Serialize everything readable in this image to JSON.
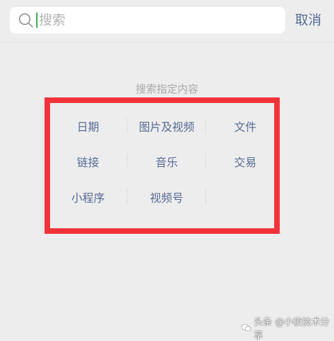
{
  "search": {
    "placeholder": "搜索",
    "value": "",
    "cancel_label": "取消"
  },
  "section": {
    "title": "搜索指定内容"
  },
  "options": {
    "row1": [
      "日期",
      "图片及视频",
      "文件"
    ],
    "row2": [
      "链接",
      "音乐",
      "交易"
    ],
    "row3": [
      "小程序",
      "视频号"
    ]
  },
  "watermark": {
    "text": "头条 @小夜技术分享"
  },
  "colors": {
    "background": "#ededed",
    "link_blue": "#576b95",
    "highlight_red": "#f2333a",
    "cursor_green": "#3ab34a"
  },
  "icons": {
    "search": "search-icon",
    "watermark_logo": "chat-bubble-icon"
  }
}
